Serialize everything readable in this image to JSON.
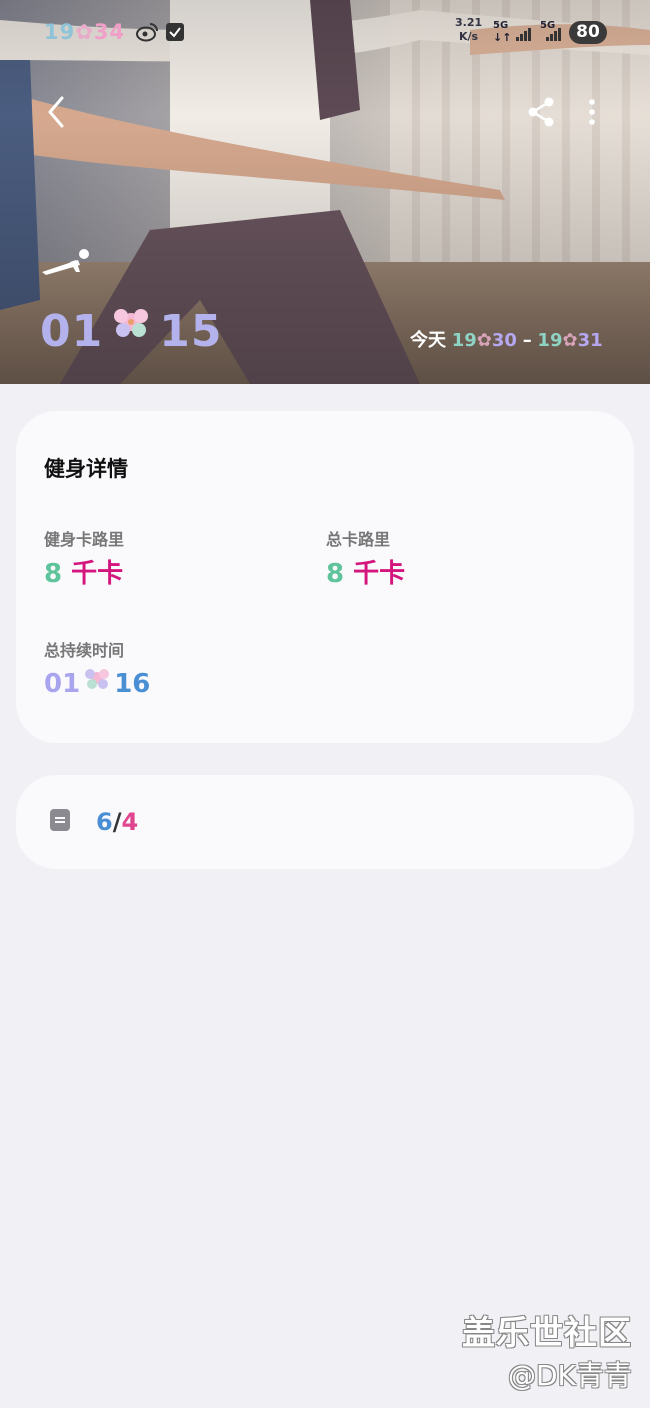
{
  "status_bar": {
    "time_h": "19",
    "time_m": "34",
    "net_speed_value": "3.21",
    "net_speed_unit": "K/s",
    "net_1": "5G",
    "net_2": "5G",
    "battery": "80"
  },
  "header": {
    "workout_duration_h": "01",
    "workout_duration_m": "15",
    "today_label": "今天",
    "start_h": "19",
    "start_m": "30",
    "dash": "–",
    "end_h": "19",
    "end_m": "31"
  },
  "details": {
    "title": "健身详情",
    "workout_calories_label": "健身卡路里",
    "workout_calories_value": "8",
    "workout_calories_unit": "千卡",
    "total_calories_label": "总卡路里",
    "total_calories_value": "8",
    "total_calories_unit": "千卡",
    "total_duration_label": "总持续时间",
    "total_duration_h": "01",
    "total_duration_m": "16"
  },
  "notes": {
    "count_a": "6",
    "separator": "/",
    "count_b": "4"
  },
  "watermark": {
    "line1": "盖乐世社区",
    "line2": "@DK青青"
  },
  "icons": {
    "back": "chevron-left-icon",
    "share": "share-icon",
    "more": "more-vertical-icon",
    "workout": "plank-icon",
    "note": "note-icon"
  }
}
